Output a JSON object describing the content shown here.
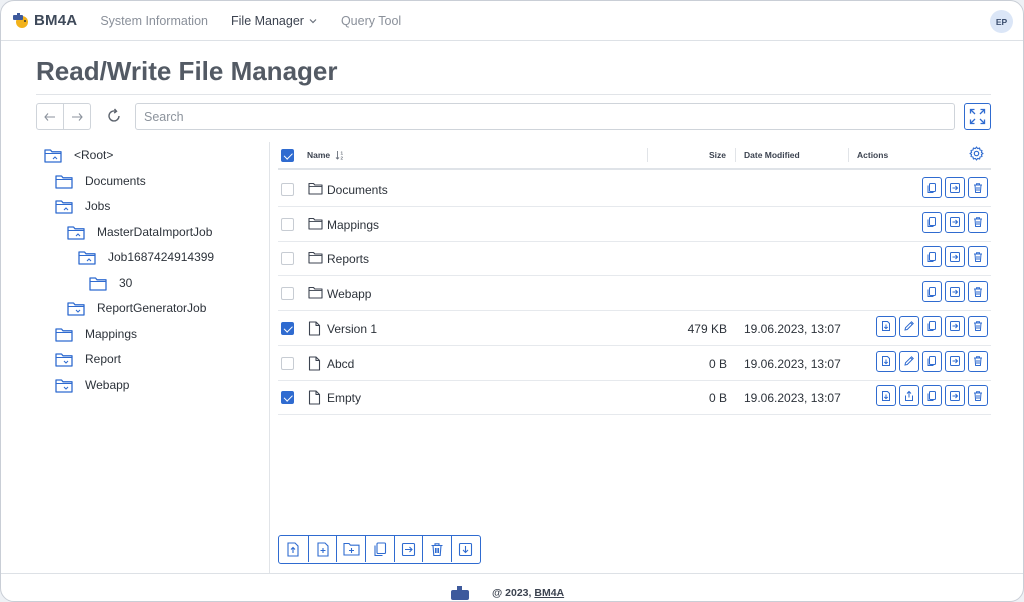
{
  "brand": {
    "name": "BM4A"
  },
  "nav": {
    "items": [
      {
        "label": "System Information"
      },
      {
        "label": "File Manager"
      },
      {
        "label": "Query Tool"
      }
    ]
  },
  "user": {
    "initials": "EP"
  },
  "page": {
    "title": "Read/Write File Manager"
  },
  "toolbar": {
    "search_placeholder": "Search"
  },
  "tree": [
    {
      "label": "<Root>",
      "state": "open"
    },
    {
      "label": "Documents",
      "state": "closed"
    },
    {
      "label": "Jobs",
      "state": "open"
    },
    {
      "label": "MasterDataImportJob",
      "state": "open"
    },
    {
      "label": "Job1687424914399",
      "state": "open"
    },
    {
      "label": "30",
      "state": "closed"
    },
    {
      "label": "ReportGeneratorJob",
      "state": "collapsed"
    },
    {
      "label": "Mappings",
      "state": "closed"
    },
    {
      "label": "Report",
      "state": "collapsed"
    },
    {
      "label": "Webapp",
      "state": "collapsed"
    }
  ],
  "table": {
    "headers": {
      "name": "Name",
      "size": "Size",
      "date": "Date Modified",
      "actions": "Actions"
    },
    "header_checked": true,
    "rows": [
      {
        "type": "folder",
        "name": "Documents",
        "size": "",
        "date": "",
        "checked": false
      },
      {
        "type": "folder",
        "name": "Mappings",
        "size": "",
        "date": "",
        "checked": false
      },
      {
        "type": "folder",
        "name": "Reports",
        "size": "",
        "date": "",
        "checked": false
      },
      {
        "type": "folder",
        "name": "Webapp",
        "size": "",
        "date": "",
        "checked": false
      },
      {
        "type": "file",
        "name": "Version 1",
        "size": "479 KB",
        "date": "19.06.2023, 13:07",
        "checked": true,
        "second_action": "edit"
      },
      {
        "type": "file",
        "name": "Abcd",
        "size": "0 B",
        "date": "19.06.2023, 13:07",
        "checked": false,
        "second_action": "edit"
      },
      {
        "type": "file",
        "name": "Empty",
        "size": "0 B",
        "date": "19.06.2023, 13:07",
        "checked": true,
        "second_action": "share"
      }
    ]
  },
  "bottom_toolbar": [
    "upload-icon",
    "new-file-icon",
    "new-folder-icon",
    "copy-icon",
    "move-icon",
    "delete-icon",
    "download-icon"
  ],
  "footer": {
    "prefix": "@ 2023, ",
    "link": "BM4A"
  },
  "colors": {
    "accent": "#2f6bd0",
    "folder": "#2f6bd0"
  }
}
